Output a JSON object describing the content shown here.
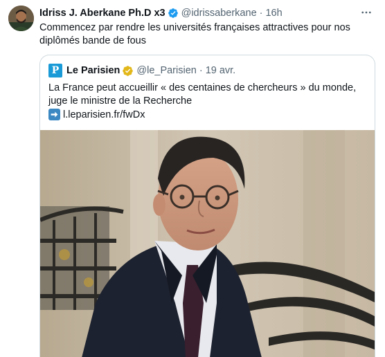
{
  "tweet": {
    "author_name": "Idriss J. Aberkane Ph.D x3",
    "handle": "@idrissaberkane",
    "separator": "·",
    "time": "16h",
    "text": "Commencez par rendre les universités françaises attractives pour nos diplômés bande de fous",
    "verified_color": "#1d9bf0"
  },
  "quote": {
    "logo_letter": "P",
    "author_name": "Le Parisien",
    "handle": "@le_Parisien",
    "separator": "·",
    "time": "19 avr.",
    "text": "La France peut accueillir « des centaines de chercheurs » du monde, juge le ministre de la Recherche",
    "link": "l.leparisien.fr/fwDx",
    "logo_color": "#1a9bd7",
    "badge_color": "#e2b719"
  },
  "icons": {
    "more": "more-horizontal-icon",
    "verified": "verified-badge-icon",
    "gold": "gold-verified-badge-icon",
    "arrow": "right-arrow-emoji-icon"
  }
}
